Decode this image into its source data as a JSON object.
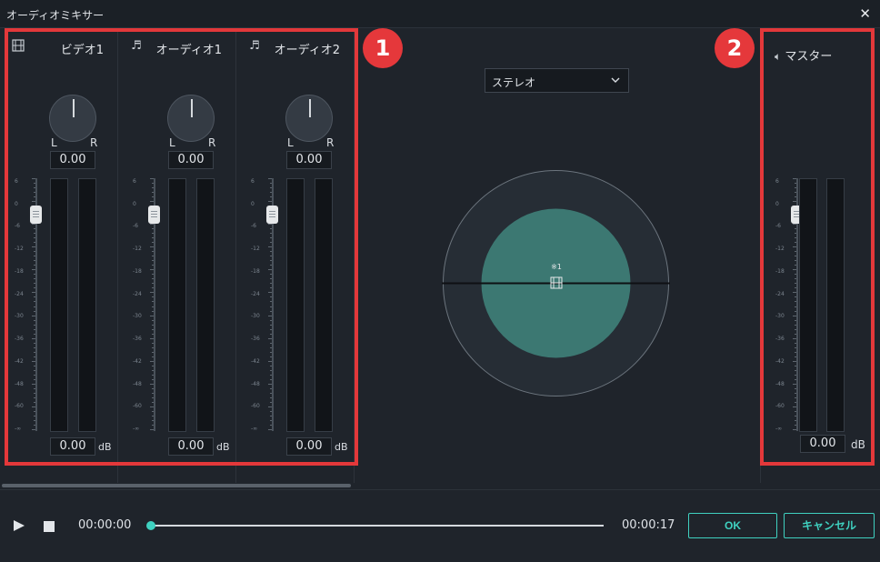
{
  "window": {
    "title": "オーディオミキサー",
    "close_icon": "close-icon"
  },
  "channels": [
    {
      "icon": "film-icon",
      "name": "ビデオ1",
      "pan_value": "0.00",
      "vol_value": "0.00",
      "left_label": "L",
      "right_label": "R",
      "db_label": "dB"
    },
    {
      "icon": "music-note-icon",
      "name": "オーディオ1",
      "pan_value": "0.00",
      "vol_value": "0.00",
      "left_label": "L",
      "right_label": "R",
      "db_label": "dB"
    },
    {
      "icon": "music-note-icon",
      "name": "オーディオ2",
      "pan_value": "0.00",
      "vol_value": "0.00",
      "left_label": "L",
      "right_label": "R",
      "db_label": "dB"
    }
  ],
  "scale_labels": [
    "6",
    "0",
    "-6",
    "-12",
    "-18",
    "-24",
    "-30",
    "-36",
    "-42",
    "-48",
    "-60",
    "-∞"
  ],
  "pan_mode": {
    "selected": "ステレオ"
  },
  "panner": {
    "track_label": "※1",
    "fill_color": "#3c7872",
    "outer_color": "#262d35"
  },
  "master": {
    "icon": "speaker-icon",
    "label": "マスター",
    "vol_value": "0.00",
    "db_label": "dB"
  },
  "annotations": {
    "badge1": "1",
    "badge2": "2",
    "color": "#e5383b"
  },
  "transport": {
    "current_time": "00:00:00",
    "total_time": "00:00:17",
    "progress": 0,
    "ok_label": "OK",
    "cancel_label": "キャンセル",
    "accent": "#3fd1c0"
  }
}
